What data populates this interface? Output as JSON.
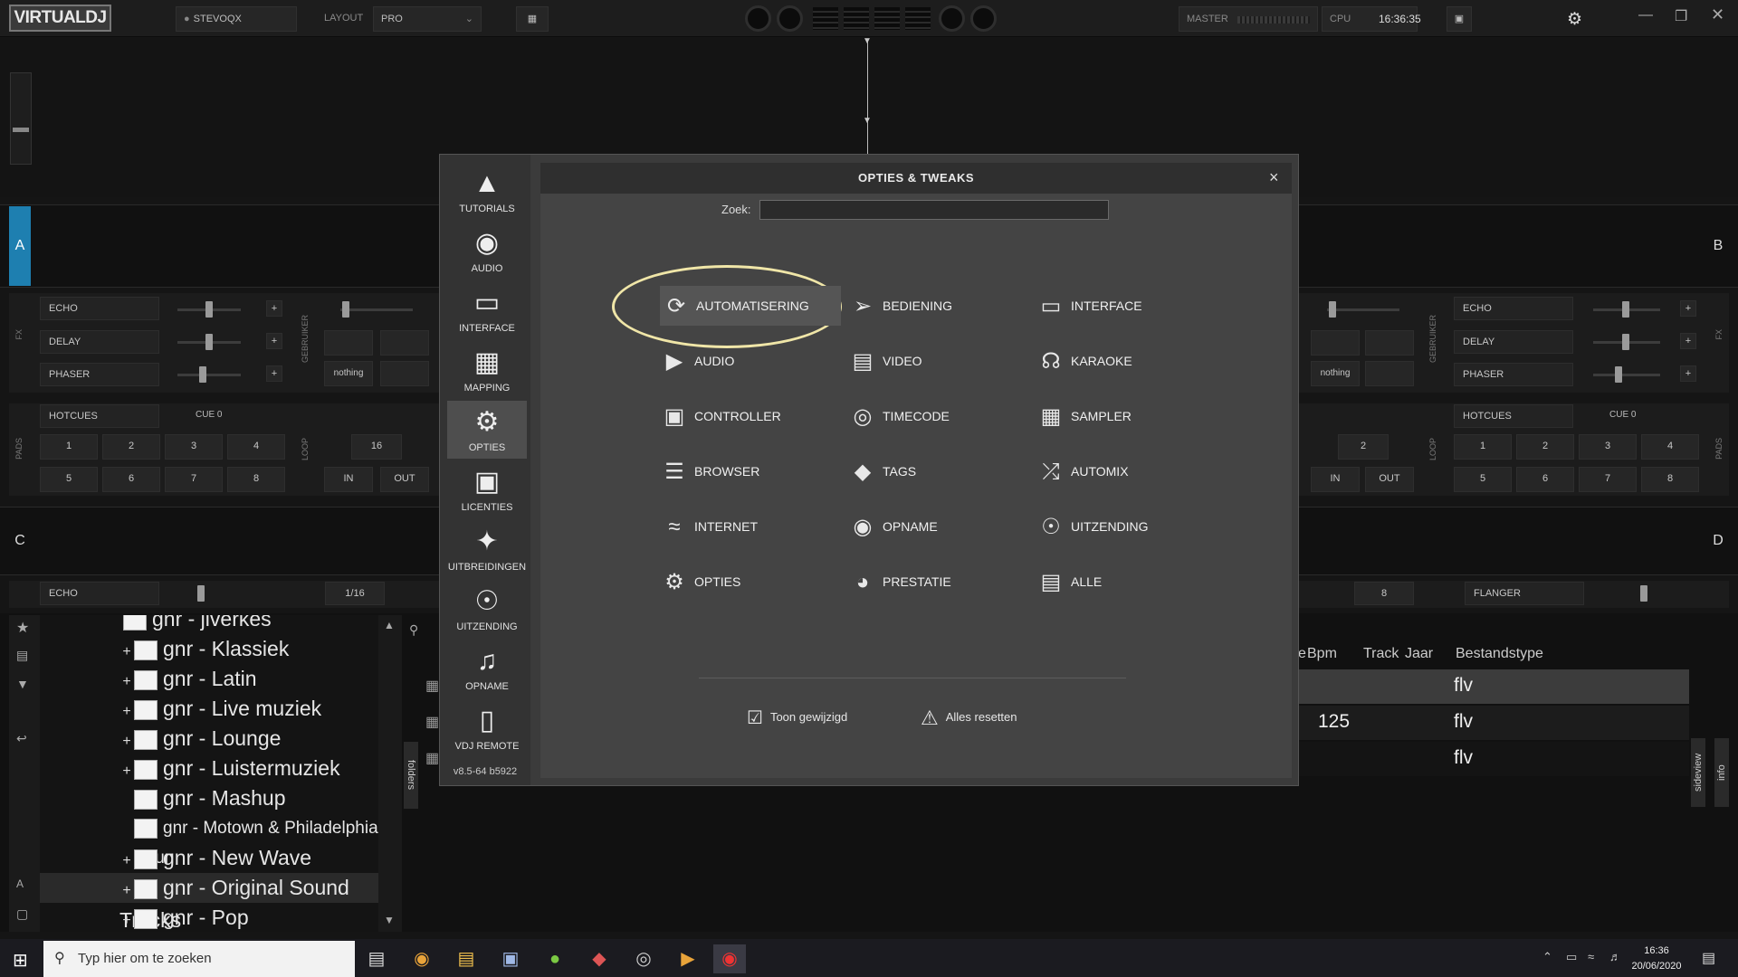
{
  "topbar": {
    "logo": "VIRTUALDJ",
    "user": "STEVOQX",
    "layout_label": "LAYOUT",
    "layout_value": "PRO",
    "master_label": "MASTER",
    "cpu_label": "CPU",
    "clock": "16:36:35"
  },
  "decks": {
    "left_label_a": "A",
    "right_label_b": "B",
    "left_label_c": "C",
    "right_label_d": "D",
    "fx_label": "FX",
    "pads_label": "PADS",
    "loop_label": "LOOP",
    "gebruiker_label": "GEBRUIKER",
    "left_fx": [
      "ECHO",
      "DELAY",
      "PHASER"
    ],
    "right_fx": [
      "ECHO",
      "DELAY",
      "PHASER"
    ],
    "nothing": "nothing",
    "hotcues": "HOTCUES",
    "cue": "CUE 0",
    "pads_left": [
      "1",
      "2",
      "3",
      "4",
      "5",
      "6",
      "7",
      "8"
    ],
    "pads_right": [
      "1",
      "2",
      "3",
      "4",
      "5",
      "6",
      "7",
      "8"
    ],
    "loop_left_value": "16",
    "loop_right_value": "2",
    "in": "IN",
    "out": "OUT",
    "lower_left_fx": "ECHO",
    "lower_left_beat": "1/16",
    "lower_right_value": "8",
    "lower_right_fx": "FLANGER"
  },
  "browser": {
    "folders": [
      {
        "name": "gnr - jiverkes",
        "plus": false
      },
      {
        "name": "gnr - Klassiek",
        "plus": true
      },
      {
        "name": "gnr - Latin",
        "plus": true
      },
      {
        "name": "gnr - Live muziek",
        "plus": true
      },
      {
        "name": "gnr - Lounge",
        "plus": true
      },
      {
        "name": "gnr - Luistermuziek",
        "plus": true
      },
      {
        "name": "gnr - Mashup",
        "plus": false
      },
      {
        "name": "gnr - Motown & Philadelphia Soun",
        "plus": false
      },
      {
        "name": "gnr - New Wave",
        "plus": true
      },
      {
        "name": "gnr - Original Sound Tracks",
        "plus": true
      },
      {
        "name": "gnr - Pop",
        "plus": true
      }
    ],
    "plus_sign": "+",
    "folders_tab": "folders",
    "sideview_tab": "sideview",
    "info_tab": "info",
    "columns": [
      "Bpm",
      "Track",
      "Jaar",
      "Bestandstype"
    ],
    "col_prefix": "e",
    "rows": [
      {
        "bpm": "",
        "type": "flv"
      },
      {
        "bpm": "125",
        "type": "flv"
      },
      {
        "bpm": "",
        "type": "flv"
      }
    ]
  },
  "dialog": {
    "title": "OPTIES & TWEAKS",
    "close": "×",
    "search_label": "Zoek:",
    "search_value": "",
    "version": "v8.5-64 b5922",
    "nav": [
      {
        "label": "TUTORIALS",
        "icon": "graduation-cap"
      },
      {
        "label": "AUDIO",
        "icon": "speaker"
      },
      {
        "label": "INTERFACE",
        "icon": "monitor"
      },
      {
        "label": "MAPPING",
        "icon": "sliders"
      },
      {
        "label": "OPTIES",
        "icon": "gear"
      },
      {
        "label": "LICENTIES",
        "icon": "lock"
      },
      {
        "label": "UITBREIDINGEN",
        "icon": "puzzle"
      },
      {
        "label": "UITZENDING",
        "icon": "broadcast"
      },
      {
        "label": "OPNAME",
        "icon": "music-folder"
      },
      {
        "label": "VDJ REMOTE",
        "icon": "phone"
      }
    ],
    "options": [
      {
        "label": "AUTOMATISERING",
        "icon": "automation"
      },
      {
        "label": "BEDIENING",
        "icon": "cursor"
      },
      {
        "label": "INTERFACE",
        "icon": "laptop"
      },
      {
        "label": "AUDIO",
        "icon": "speaker"
      },
      {
        "label": "VIDEO",
        "icon": "film"
      },
      {
        "label": "KARAOKE",
        "icon": "microphone"
      },
      {
        "label": "CONTROLLER",
        "icon": "controller"
      },
      {
        "label": "TIMECODE",
        "icon": "vinyl"
      },
      {
        "label": "SAMPLER",
        "icon": "grid"
      },
      {
        "label": "BROWSER",
        "icon": "list"
      },
      {
        "label": "TAGS",
        "icon": "tag"
      },
      {
        "label": "AUTOMIX",
        "icon": "shuffle"
      },
      {
        "label": "INTERNET",
        "icon": "wifi"
      },
      {
        "label": "OPNAME",
        "icon": "rec"
      },
      {
        "label": "UITZENDING",
        "icon": "antenna"
      },
      {
        "label": "OPTIES",
        "icon": "gear"
      },
      {
        "label": "PRESTATIE",
        "icon": "gauge"
      },
      {
        "label": "ALLE",
        "icon": "document"
      }
    ],
    "show_changed": "Toon gewijzigd",
    "reset_all": "Alles resetten"
  },
  "taskbar": {
    "search_placeholder": "Typ hier om te zoeken",
    "time": "16:36",
    "date": "20/06/2020"
  },
  "colors": {
    "highlight_ring": "#f0e6a8",
    "deck_a": "#1e7fb0"
  }
}
